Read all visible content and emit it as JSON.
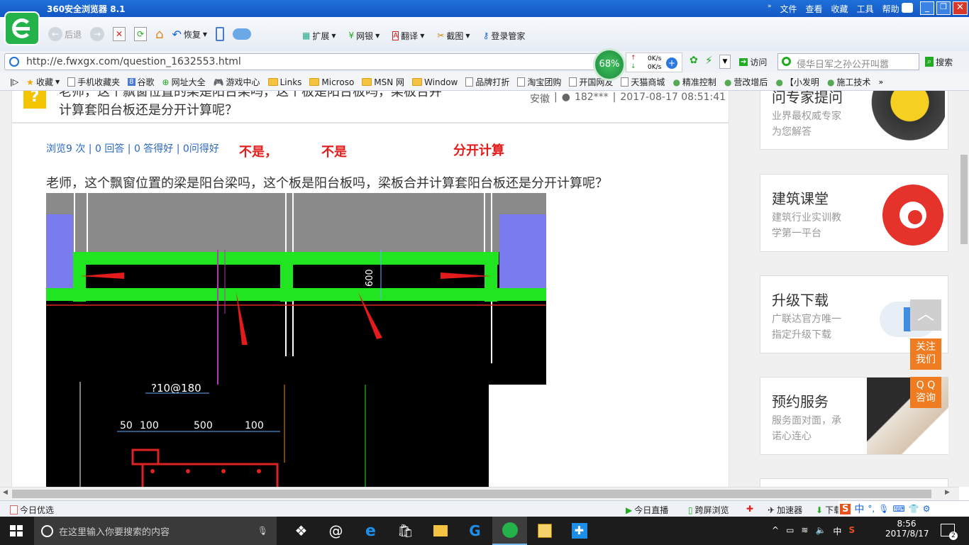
{
  "window": {
    "title": "360安全浏览器 8.1"
  },
  "menu": [
    "文件",
    "查看",
    "收藏",
    "工具",
    "帮助"
  ],
  "toolbar": {
    "back": "后退",
    "restore": "恢复",
    "extend": "扩展",
    "netbank": "网银",
    "translate": "翻译",
    "screenshot": "截图",
    "login": "登录管家"
  },
  "address": {
    "url": "http://e.fwxgx.com/question_1632553.html",
    "cpu": "68%",
    "speed_up": "0K/s",
    "speed_down": "0K/s",
    "visit": "访问",
    "search_value": "侵华日军之孙公开叫嚣",
    "search_btn": "搜索"
  },
  "favorites": [
    "收藏",
    "手机收藏夹",
    "谷歌",
    "网址大全",
    "游戏中心",
    "Links",
    "Microso",
    "MSN 网",
    "Window",
    "品牌打折",
    "淘宝团购",
    "开国网友",
    "天猫商城",
    "精准控制",
    "营改增后",
    "【小发明",
    "施工技术"
  ],
  "question": {
    "title_line1": "老师，这个飘窗位置的梁是阳台梁吗，这个板是阳台板吗，梁板合并",
    "title_line2": "计算套阳台板还是分开计算呢？",
    "meta_location": "安徽",
    "meta_user": "182***",
    "meta_time": "2017-08-17 08:51:41",
    "stats": "浏览9 次 | 0 回答 | 0 答得好 | 0问得好",
    "annot1": "不是，",
    "annot2": "不是",
    "annot3": "分开计算",
    "body": "老师，这个飘窗位置的梁是阳台梁吗，这个板是阳台板吗，梁板合并计算套阳台板还是分开计算呢？"
  },
  "cad": {
    "label_600": "600",
    "rebar": "?10@180",
    "dims": [
      "50",
      "100",
      "500",
      "100"
    ]
  },
  "sidebar": [
    {
      "title": "问专家提问",
      "desc1": "业界最权威专家",
      "desc2": "为您解答"
    },
    {
      "title": "建筑课堂",
      "desc1": "建筑行业实训教",
      "desc2": "学第一平台"
    },
    {
      "title": "升级下载",
      "desc1": "广联达官方唯一",
      "desc2": "指定升级下载"
    },
    {
      "title": "预约服务",
      "desc1": "服务面对面，承",
      "desc2": "诺心连心"
    }
  ],
  "float": {
    "follow1": "关注",
    "follow2": "我们",
    "qq1": "Q Q",
    "qq2": "咨询"
  },
  "status": {
    "today": "今日优选",
    "live": "今日直播",
    "cross": "跨屏浏览",
    "accel": "加速器",
    "download": "下载"
  },
  "taskbar": {
    "search_placeholder": "在这里输入你要搜索的内容",
    "time": "8:56",
    "date": "2017/8/17",
    "ime": "中",
    "notif_count": "2"
  },
  "colors": {
    "title_blue": "#1565d8",
    "cad_green": "#21e521",
    "annot_red": "#e31b1b",
    "orange": "#f07c22"
  }
}
